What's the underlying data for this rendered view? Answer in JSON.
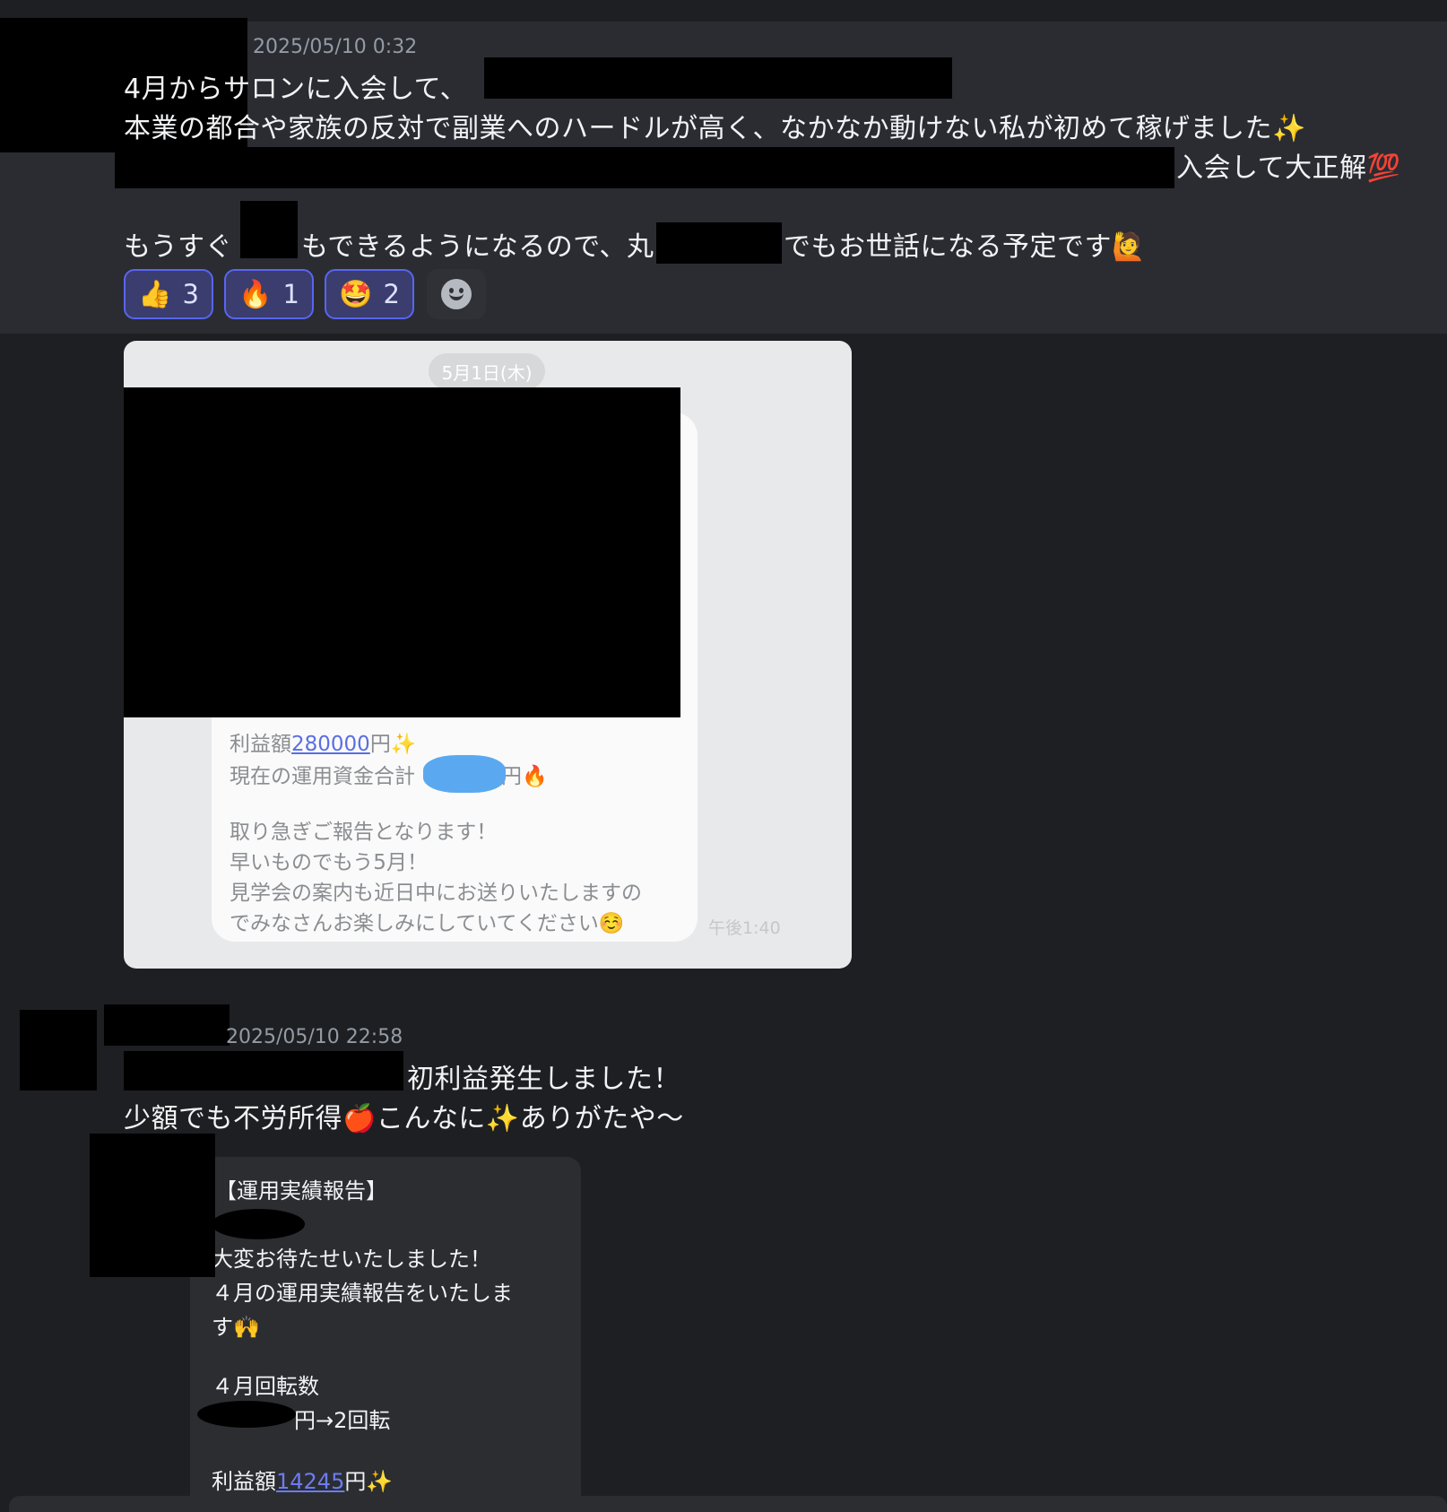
{
  "message1": {
    "timestamp": "2025/05/10 0:32",
    "line1": "4月からサロンに入会して、",
    "line2": "本業の都合や家族の反対で副業へのハードルが高く、なかなか動けない私が初めて稼げました✨",
    "line3": "入会して大正解💯",
    "line4a": "もうすぐ",
    "line4b": "もできるようになるので、丸",
    "line4c": "でもお世話になる予定です🙋",
    "reactions": [
      {
        "emoji": "👍",
        "count": "3"
      },
      {
        "emoji": "🔥",
        "count": "1"
      },
      {
        "emoji": "🤩",
        "count": "2"
      }
    ],
    "add_reaction_icon": "add-reaction-icon"
  },
  "attachment1": {
    "date": "5月1日(木)",
    "profit_label": "利益額",
    "profit_value": "280000",
    "profit_suffix": "円✨",
    "fund_label": "現在の運用資金合計",
    "fund_suffix": "円🔥",
    "line_a": "取り急ぎご報告となります！",
    "line_b": "早いものでもう5月！",
    "line_c": "見学会の案内も近日中にお送りいたしますの",
    "line_d": "でみなさんお楽しみにしていてください☺️",
    "time": "午後1:40"
  },
  "message2": {
    "timestamp": "2025/05/10 22:58",
    "line1": "初利益発生しました！",
    "line2": "少額でも不労所得🍎こんなに✨ありがたや〜"
  },
  "attachment2": {
    "title": "【運用実績報告】",
    "line_a": "大変お待たせいたしました！",
    "line_b": "４月の運用実績報告をいたしま",
    "line_c": "す🙌",
    "line_d": "４月回転数",
    "line_e": "円→2回転",
    "profit_label": "利益額",
    "profit_value": "14245",
    "profit_suffix": "円✨"
  }
}
